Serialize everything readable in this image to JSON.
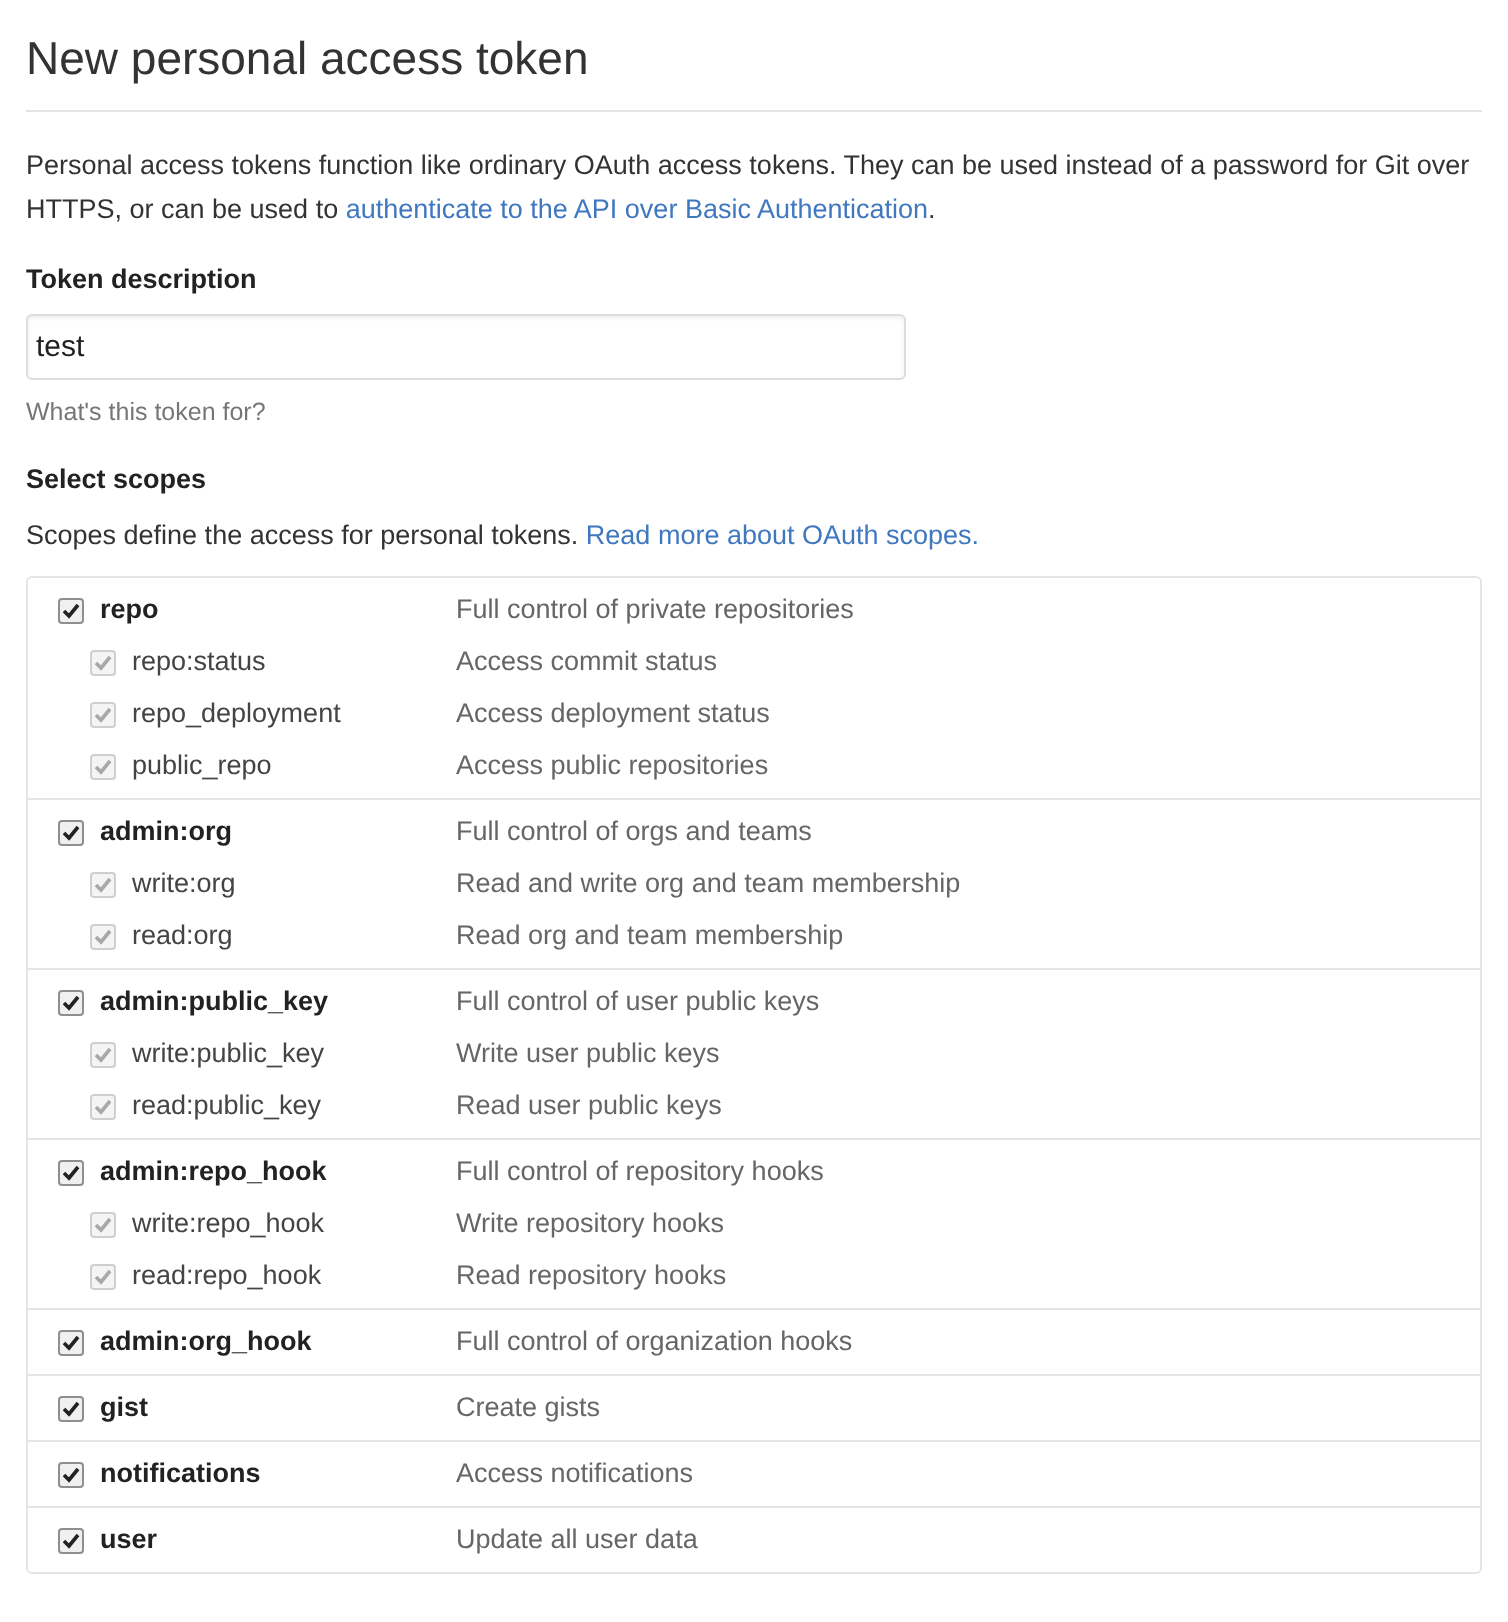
{
  "title": "New personal access token",
  "intro": {
    "text": "Personal access tokens function like ordinary OAuth access tokens. They can be used instead of a password for Git over HTTPS, or can be used to ",
    "link": "authenticate to the API over Basic Authentication",
    "end": "."
  },
  "token_description": {
    "label": "Token description",
    "value": "test",
    "hint": "What's this token for?"
  },
  "scopes_heading": "Select scopes",
  "scopes_intro": {
    "text": "Scopes define the access for personal tokens. ",
    "link": "Read more about OAuth scopes."
  },
  "scopes": [
    {
      "name": "repo",
      "description": "Full control of private repositories",
      "checked": true,
      "children": [
        {
          "name": "repo:status",
          "description": "Access commit status",
          "checked": true,
          "disabled": true
        },
        {
          "name": "repo_deployment",
          "description": "Access deployment status",
          "checked": true,
          "disabled": true
        },
        {
          "name": "public_repo",
          "description": "Access public repositories",
          "checked": true,
          "disabled": true
        }
      ]
    },
    {
      "name": "admin:org",
      "description": "Full control of orgs and teams",
      "checked": true,
      "children": [
        {
          "name": "write:org",
          "description": "Read and write org and team membership",
          "checked": true,
          "disabled": true
        },
        {
          "name": "read:org",
          "description": "Read org and team membership",
          "checked": true,
          "disabled": true
        }
      ]
    },
    {
      "name": "admin:public_key",
      "description": "Full control of user public keys",
      "checked": true,
      "children": [
        {
          "name": "write:public_key",
          "description": "Write user public keys",
          "checked": true,
          "disabled": true
        },
        {
          "name": "read:public_key",
          "description": "Read user public keys",
          "checked": true,
          "disabled": true
        }
      ]
    },
    {
      "name": "admin:repo_hook",
      "description": "Full control of repository hooks",
      "checked": true,
      "children": [
        {
          "name": "write:repo_hook",
          "description": "Write repository hooks",
          "checked": true,
          "disabled": true
        },
        {
          "name": "read:repo_hook",
          "description": "Read repository hooks",
          "checked": true,
          "disabled": true
        }
      ]
    },
    {
      "name": "admin:org_hook",
      "description": "Full control of organization hooks",
      "checked": true
    },
    {
      "name": "gist",
      "description": "Create gists",
      "checked": true
    },
    {
      "name": "notifications",
      "description": "Access notifications",
      "checked": true
    },
    {
      "name": "user",
      "description": "Update all user data",
      "checked": true
    }
  ]
}
